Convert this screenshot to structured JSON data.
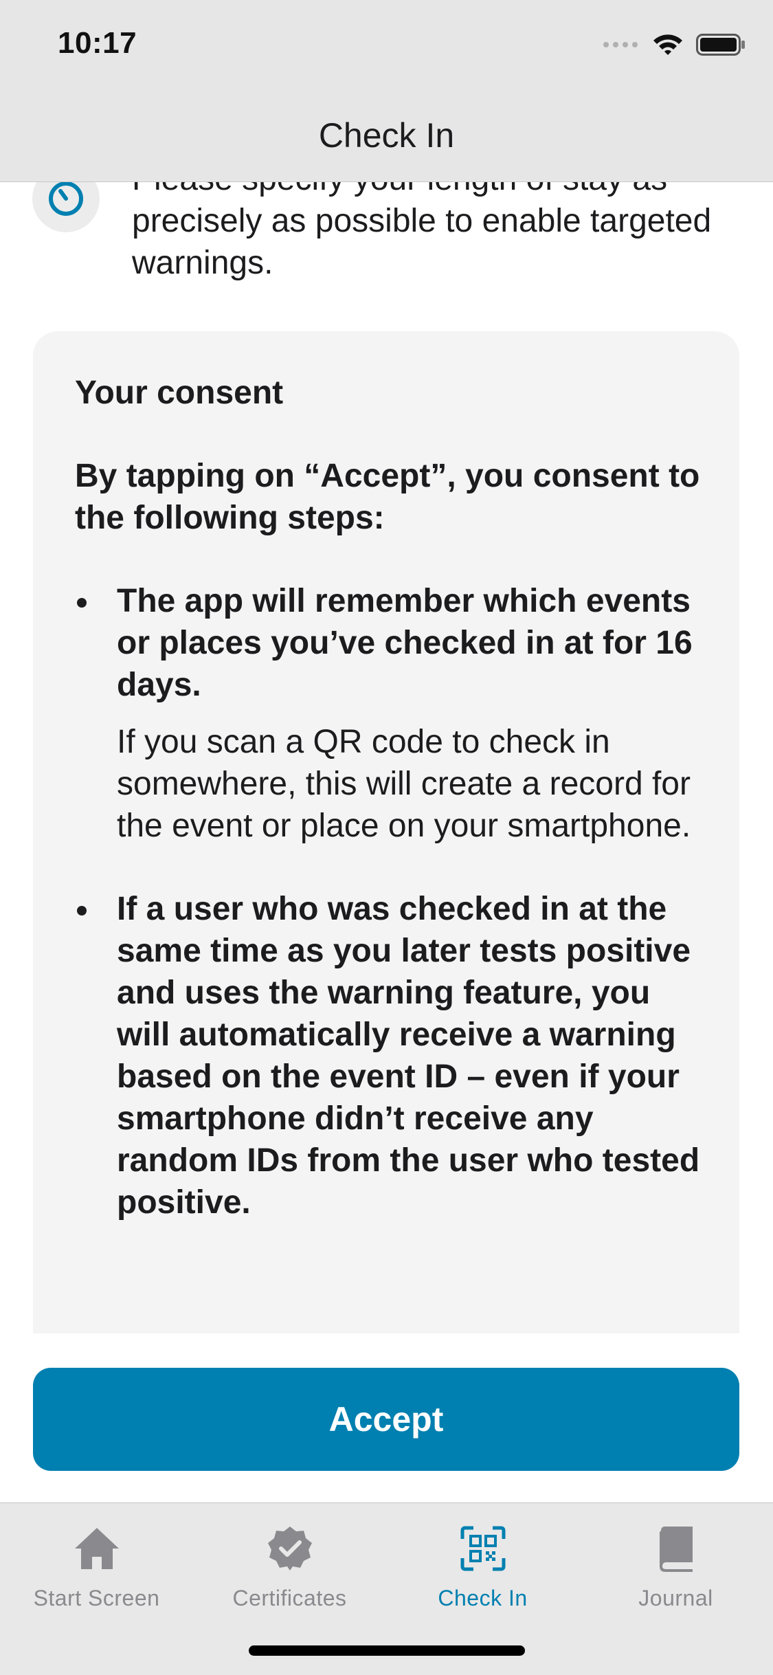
{
  "status_bar": {
    "time": "10:17"
  },
  "nav": {
    "title": "Check In"
  },
  "stay_notice": {
    "icon": "timer-icon",
    "text": "Please specify your length of stay as precisely as possible to enable targeted warnings."
  },
  "consent": {
    "title": "Your consent",
    "intro": "By tapping on “Accept”, you consent to the following steps:",
    "bullets": [
      {
        "heading": "The app will remember which events or places you’ve checked in at for 16 days.",
        "body": "If you scan a QR code to check in somewhere, this will create a record for the event or place on your smartphone."
      },
      {
        "heading": "If a user who was checked in at the same time as you later tests positive and uses the warning feature, you will automatically receive a warning based on the event ID – even if your smartphone didn’t receive any random IDs from the user who tested positive.",
        "body": ""
      }
    ]
  },
  "accept_button": {
    "label": "Accept"
  },
  "tab_bar": {
    "tabs": [
      {
        "label": "Start Screen",
        "icon": "home-icon",
        "active": false
      },
      {
        "label": "Certificates",
        "icon": "certificate-icon",
        "active": false
      },
      {
        "label": "Check In",
        "icon": "qr-code-icon",
        "active": true
      },
      {
        "label": "Journal",
        "icon": "journal-icon",
        "active": false
      }
    ]
  },
  "colors": {
    "accent": "#0080b0",
    "inactive_tab": "#8a8a8e",
    "card_background": "#f4f4f4"
  }
}
